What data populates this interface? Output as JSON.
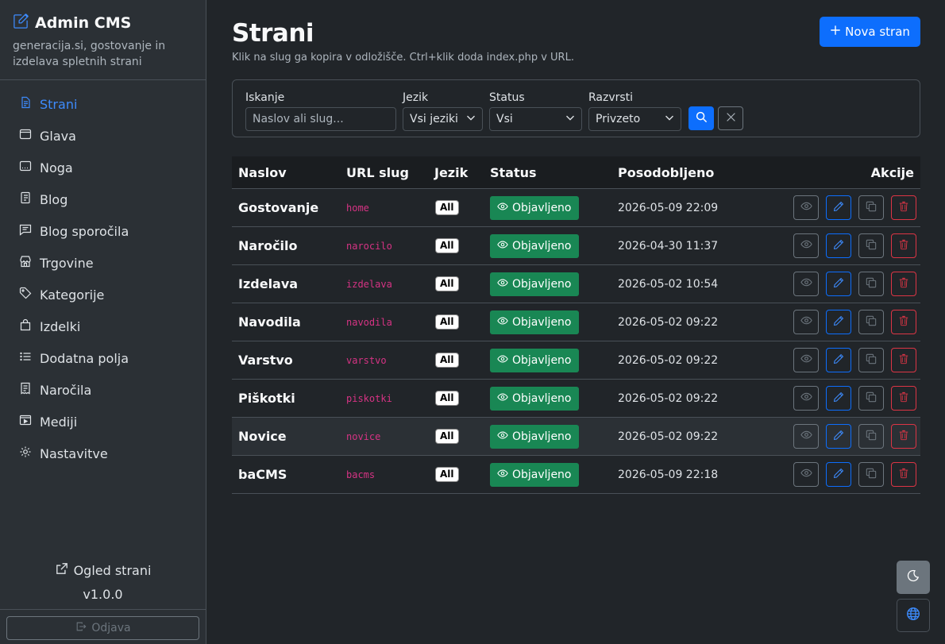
{
  "brand": {
    "title": "Admin CMS",
    "subtitle": "generacija.si, gostovanje in izdelava spletnih strani"
  },
  "sidebar": {
    "items": [
      {
        "label": "Strani",
        "icon": "file-text-icon",
        "active": true
      },
      {
        "label": "Glava",
        "icon": "window-icon"
      },
      {
        "label": "Noga",
        "icon": "window-footer-icon"
      },
      {
        "label": "Blog",
        "icon": "journal-icon"
      },
      {
        "label": "Blog sporočila",
        "icon": "chat-square-icon"
      },
      {
        "label": "Trgovine",
        "icon": "shop-icon"
      },
      {
        "label": "Kategorije",
        "icon": "tags-icon"
      },
      {
        "label": "Izdelki",
        "icon": "bag-icon"
      },
      {
        "label": "Dodatna polja",
        "icon": "list-ul-icon"
      },
      {
        "label": "Naročila",
        "icon": "receipt-icon"
      },
      {
        "label": "Mediji",
        "icon": "film-icon"
      },
      {
        "label": "Nastavitve",
        "icon": "gear-icon"
      }
    ],
    "view_site": "Ogled strani",
    "version": "v1.0.0",
    "logout": "Odjava"
  },
  "header": {
    "title": "Strani",
    "hint": "Klik na slug ga kopira v odložišče. Ctrl+klik doda index.php v URL.",
    "new_button": "Nova stran"
  },
  "filters": {
    "search_label": "Iskanje",
    "search_placeholder": "Naslov ali slug...",
    "language_label": "Jezik",
    "language_value": "Vsi jeziki",
    "status_label": "Status",
    "status_value": "Vsi",
    "sort_label": "Razvrsti",
    "sort_value": "Privzeto"
  },
  "table": {
    "columns": {
      "title": "Naslov",
      "slug": "URL slug",
      "lang": "Jezik",
      "status": "Status",
      "updated": "Posodobljeno",
      "actions": "Akcije"
    },
    "rows": [
      {
        "title": "Gostovanje",
        "slug": "home",
        "lang": "All",
        "status": "Objavljeno",
        "updated": "2026-05-09 22:09"
      },
      {
        "title": "Naročilo",
        "slug": "narocilo",
        "lang": "All",
        "status": "Objavljeno",
        "updated": "2026-04-30 11:37"
      },
      {
        "title": "Izdelava",
        "slug": "izdelava",
        "lang": "All",
        "status": "Objavljeno",
        "updated": "2026-05-02 10:54"
      },
      {
        "title": "Navodila",
        "slug": "navodila",
        "lang": "All",
        "status": "Objavljeno",
        "updated": "2026-05-02 09:22"
      },
      {
        "title": "Varstvo",
        "slug": "varstvo",
        "lang": "All",
        "status": "Objavljeno",
        "updated": "2026-05-02 09:22"
      },
      {
        "title": "Piškotki",
        "slug": "piskotki",
        "lang": "All",
        "status": "Objavljeno",
        "updated": "2026-05-02 09:22"
      },
      {
        "title": "Novice",
        "slug": "novice",
        "lang": "All",
        "status": "Objavljeno",
        "updated": "2026-05-02 09:22",
        "hover": true
      },
      {
        "title": "baCMS",
        "slug": "bacms",
        "lang": "All",
        "status": "Objavljeno",
        "updated": "2026-05-09 22:18"
      }
    ]
  },
  "colors": {
    "accent": "#0d6efd",
    "success": "#198754",
    "danger": "#dc3545",
    "slug": "#d63384"
  }
}
